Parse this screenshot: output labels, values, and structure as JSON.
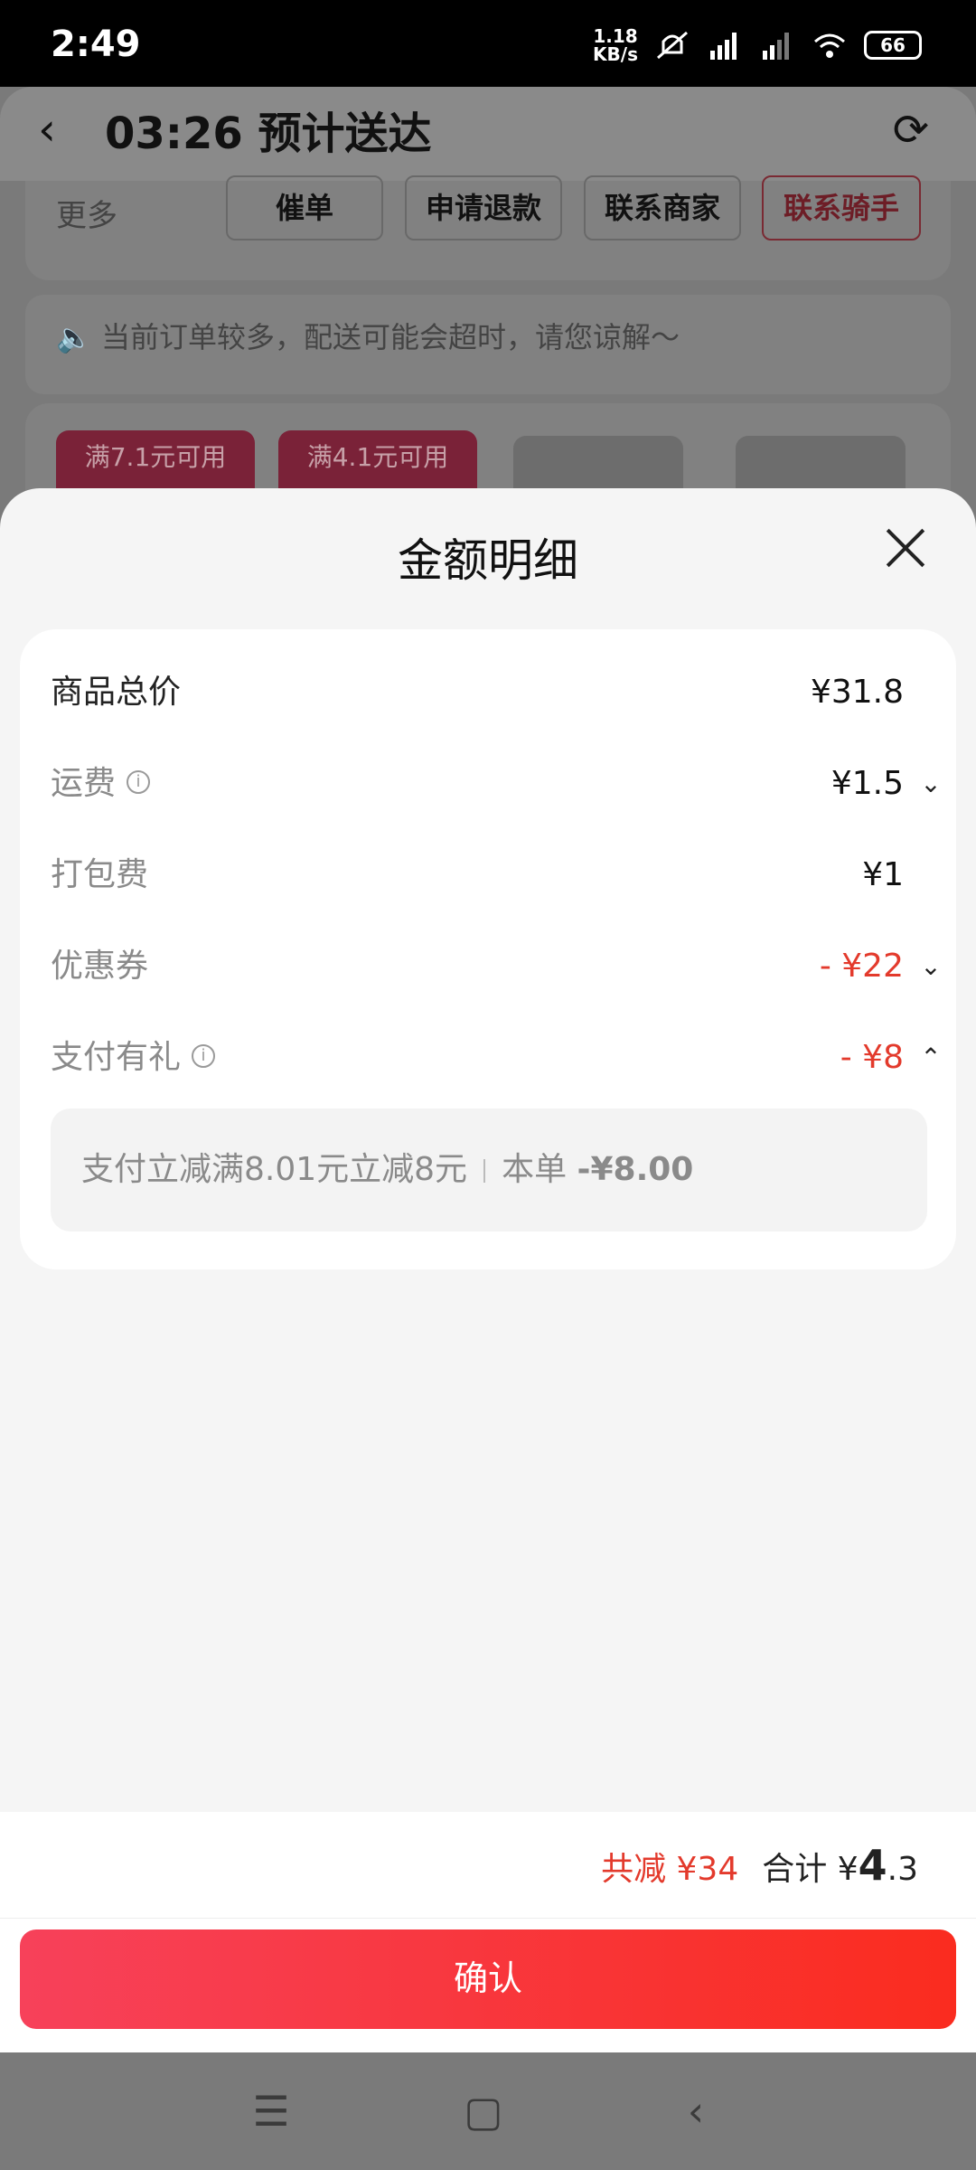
{
  "status_bar": {
    "time": "2:49",
    "net_speed_value": "1.18",
    "net_speed_unit": "KB/s",
    "battery": "66"
  },
  "background_page": {
    "title": "03:26 预计送达",
    "more_label": "更多",
    "actions": [
      "催单",
      "申请退款",
      "联系商家",
      "联系骑手"
    ],
    "notice": "当前订单较多，配送可能会超时，请您谅解～",
    "coupons": [
      "满7.1元可用",
      "满4.1元可用"
    ]
  },
  "sheet": {
    "title": "金额明细",
    "rows": [
      {
        "label": "商品总价",
        "value": "¥31.8"
      },
      {
        "label": "运费",
        "value": "¥1.5"
      },
      {
        "label": "打包费",
        "value": "¥1"
      },
      {
        "label": "优惠券",
        "value": "- ¥22"
      },
      {
        "label": "支付有礼",
        "value": "- ¥8"
      }
    ],
    "promo": {
      "desc": "支付立减满8.01元立减8元",
      "scope": "本单",
      "amount": "-¥8.00"
    }
  },
  "footer": {
    "saved_label": "共减",
    "saved_value": "¥34",
    "total_label": "合计",
    "total_currency": "¥",
    "total_int": "4",
    "total_dec": ".3",
    "confirm_label": "确认"
  },
  "colors": {
    "accent_red": "#e33a2c",
    "confirm_gradient_start": "#f7415a",
    "confirm_gradient_end": "#fa2c1f"
  }
}
